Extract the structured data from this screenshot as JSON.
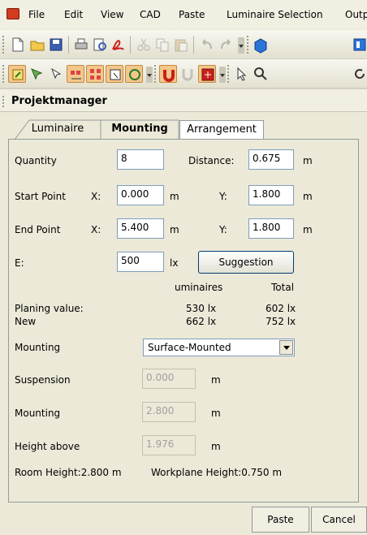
{
  "menubar": {
    "items": [
      "File",
      "Edit",
      "View",
      "CAD",
      "Paste",
      "Luminaire Selection",
      "Outp"
    ]
  },
  "panel": {
    "title": "Projektmanager"
  },
  "tabs": [
    {
      "label": "Luminaire",
      "active": false
    },
    {
      "label": "Mounting",
      "active": true
    },
    {
      "label": "Arrangement",
      "active": false
    }
  ],
  "form": {
    "quantity_label": "Quantity",
    "quantity_value": "8",
    "distance_label": "Distance:",
    "distance_value": "0.675",
    "distance_unit": "m",
    "start_label": "Start Point",
    "start_x_label": "X:",
    "start_x_value": "0.000",
    "start_x_unit": "m",
    "start_y_label": "Y:",
    "start_y_value": "1.800",
    "start_y_unit": "m",
    "end_label": "End Point",
    "end_x_label": "X:",
    "end_x_value": "5.400",
    "end_x_unit": "m",
    "end_y_label": "Y:",
    "end_y_value": "1.800",
    "end_y_unit": "m",
    "e_label": "E:",
    "e_value": "500",
    "e_unit": "lx",
    "suggestion_label": "Suggestion"
  },
  "results": {
    "col_luminaires": "uminaires",
    "col_total": "Total",
    "planing_label": "Planing value:",
    "planing_luminaires": "530 lx",
    "planing_total": "602 lx",
    "new_label": "New",
    "new_luminaires": "662 lx",
    "new_total": "752 lx"
  },
  "mounting": {
    "mounting_label": "Mounting",
    "mounting_selected": "Surface-Mounted",
    "suspension_label": "Suspension",
    "suspension_value": "0.000",
    "suspension_unit": "m",
    "mounting_height_label": "Mounting",
    "mounting_height_value": "2.800",
    "mounting_height_unit": "m",
    "height_above_label": "Height above",
    "height_above_value": "1.976",
    "height_above_unit": "m",
    "room_height_text": "Room Height:2.800 m",
    "workplane_text": "Workplane Height:0.750 m"
  },
  "bottom": {
    "paste_label": "Paste",
    "cancel_label": "Cancel"
  },
  "colors": {
    "background": "#ece9d8",
    "panel_border": "#919b9c",
    "input_border": "#7f9db9"
  }
}
